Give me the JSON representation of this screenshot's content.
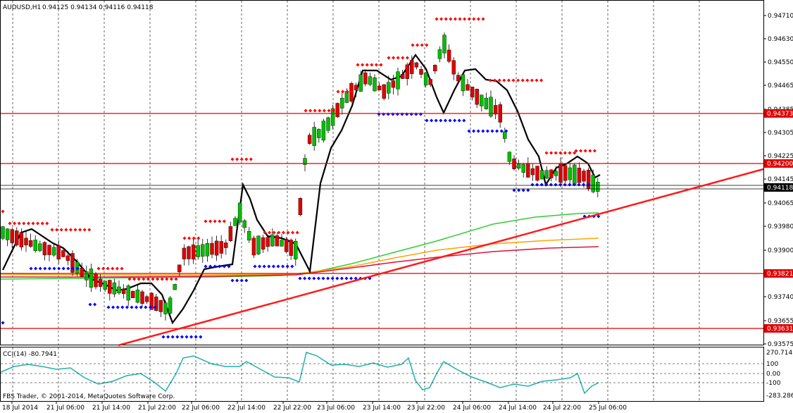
{
  "header": {
    "symbol": "AUDUSD,H1",
    "ohlc": "0.94125 0.94134 0.94116 0.94118"
  },
  "indicator": {
    "label": "CCI(14) -80.7941",
    "levels": [
      "270.714",
      "100",
      "0.00",
      "-100",
      "-283.286"
    ]
  },
  "copyright": "FBS Trader, © 2001-2014, MetaQuotes Software Corp.",
  "price_axis": {
    "ticks": [
      "0.94710",
      "0.94630",
      "0.94550",
      "0.94465",
      "0.94385",
      "0.94305",
      "0.94225",
      "0.94145",
      "0.94065",
      "0.93980",
      "0.93900",
      "0.93820",
      "0.93740",
      "0.93655",
      "0.93575"
    ],
    "tagged": [
      {
        "label": "0.94373",
        "color": "#e00000"
      },
      {
        "label": "0.94200",
        "color": "#e00000"
      },
      {
        "label": "0.94118",
        "color": "#000000"
      },
      {
        "label": "0.93821",
        "color": "#e00000"
      },
      {
        "label": "0.93631",
        "color": "#e00000"
      }
    ]
  },
  "time_axis": [
    "18 Jul 2014",
    "21 Jul 06:00",
    "21 Jul 14:00",
    "21 Jul 22:00",
    "22 Jul 06:00",
    "22 Jul 14:00",
    "22 Jul 22:00",
    "23 Jul 06:00",
    "23 Jul 14:00",
    "23 Jul 22:00",
    "24 Jul 06:00",
    "24 Jul 14:00",
    "24 Jul 22:00",
    "25 Jul 06:00"
  ],
  "colors": {
    "bull": "#00c000",
    "bear": "#e00000",
    "grid": "#000000",
    "support": "#ff0000",
    "ma_fast": "#000000",
    "ma_green": "#32cd32",
    "ma_orange": "#ffa500",
    "ma_red": "#dc143c",
    "cci": "#20b2aa",
    "dot_red": "#ff0000",
    "dot_blue": "#0000ff"
  }
}
